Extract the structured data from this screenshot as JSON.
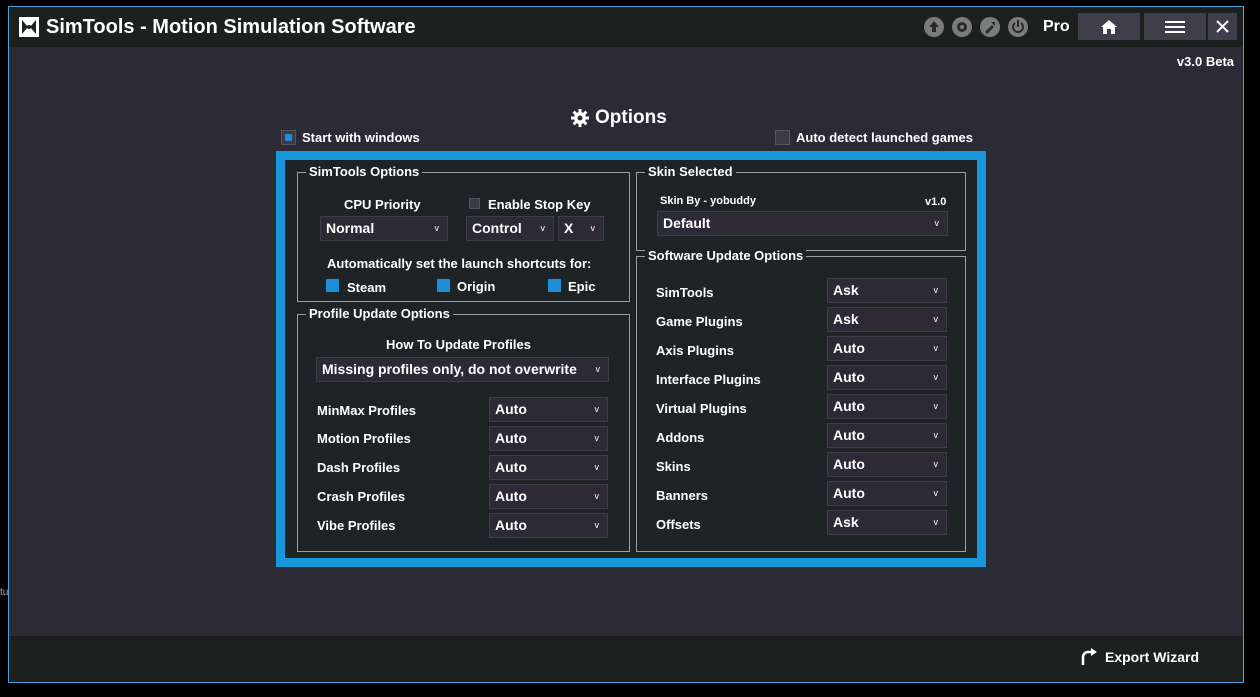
{
  "titlebar": {
    "app_title": "SimTools - Motion Simulation Software",
    "pro_label": "Pro",
    "icons": [
      "up-arrow-icon",
      "gear-badge-icon",
      "wrench-icon",
      "power-icon",
      "home-icon",
      "menu-icon",
      "close-icon"
    ]
  },
  "version": "v3.0 Beta",
  "options_title": "Options",
  "start_with_windows": {
    "label": "Start with windows",
    "checked": true
  },
  "auto_detect": {
    "label": "Auto detect launched games",
    "checked": false
  },
  "simtools_options": {
    "title": "SimTools Options",
    "cpu_priority_label": "CPU Priority",
    "cpu_priority_value": "Normal",
    "enable_stop_key_label": "Enable Stop Key",
    "enable_stop_key_checked": false,
    "stop_key_modifier": "Control",
    "stop_key": "X",
    "shortcuts_label": "Automatically set the launch shortcuts for:",
    "shortcuts": [
      {
        "label": "Steam",
        "checked": true
      },
      {
        "label": "Origin",
        "checked": true
      },
      {
        "label": "Epic",
        "checked": true
      }
    ]
  },
  "profile_update": {
    "title": "Profile Update Options",
    "how_label": "How To Update Profiles",
    "how_value": "Missing profiles only, do not overwrite",
    "rows": [
      {
        "label": "MinMax Profiles",
        "value": "Auto"
      },
      {
        "label": "Motion Profiles",
        "value": "Auto"
      },
      {
        "label": "Dash Profiles",
        "value": "Auto"
      },
      {
        "label": "Crash Profiles",
        "value": "Auto"
      },
      {
        "label": "Vibe Profiles",
        "value": "Auto"
      }
    ]
  },
  "skin": {
    "title": "Skin Selected",
    "by_label": "Skin By - yobuddy",
    "version": "v1.0",
    "value": "Default"
  },
  "software_update": {
    "title": "Software Update Options",
    "rows": [
      {
        "label": "SimTools",
        "value": "Ask"
      },
      {
        "label": "Game Plugins",
        "value": "Ask"
      },
      {
        "label": "Axis Plugins",
        "value": "Auto"
      },
      {
        "label": "Interface Plugins",
        "value": "Auto"
      },
      {
        "label": "Virtual Plugins",
        "value": "Auto"
      },
      {
        "label": "Addons",
        "value": "Auto"
      },
      {
        "label": "Skins",
        "value": "Auto"
      },
      {
        "label": "Banners",
        "value": "Auto"
      },
      {
        "label": "Offsets",
        "value": "Ask"
      }
    ]
  },
  "footer": {
    "export_label": "Export Wizard"
  },
  "dropdown_arrow": "v",
  "stray_text": "tu",
  "colors": {
    "accent": "#1798dc",
    "titlebar": "#1c211f",
    "window_bg": "#2c2a35",
    "panel_bg": "#1e2326"
  }
}
